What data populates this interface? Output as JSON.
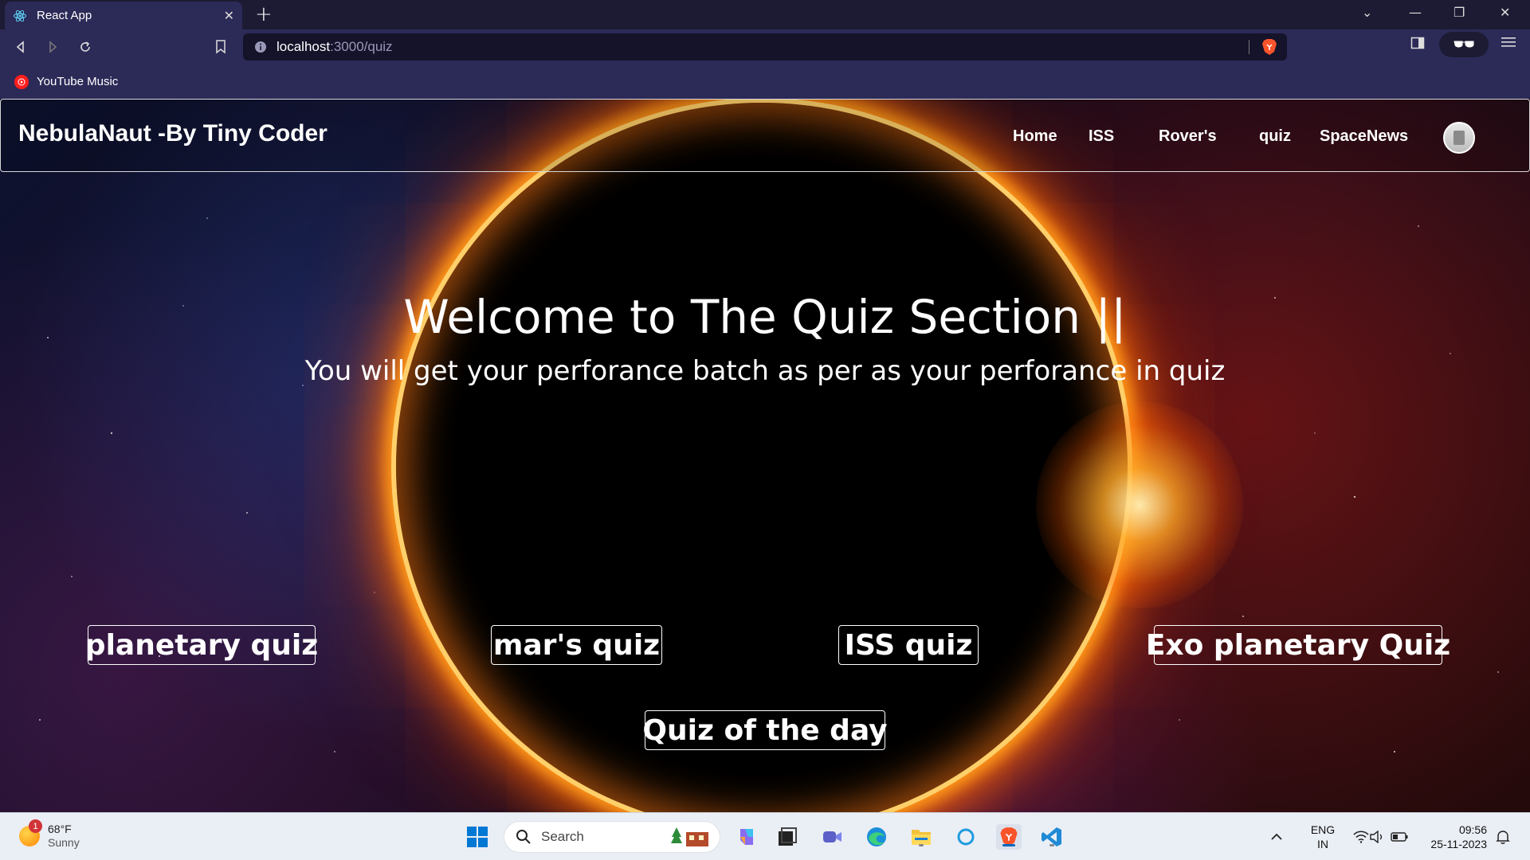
{
  "browser": {
    "tab_title": "React App",
    "url_host": "localhost",
    "url_path": ":3000/quiz",
    "bookmark_label": "YouTube Music"
  },
  "site": {
    "brand": "NebulaNaut -By Tiny Coder",
    "nav_links": [
      "Home",
      "ISS",
      "Rover's",
      "quiz",
      "SpaceNews"
    ]
  },
  "hero": {
    "title": "Welcome to The Quiz Section ||",
    "subtitle": "You will get your perforance batch as per as your perforance in quiz"
  },
  "quizzes": {
    "planetary": "planetary quiz",
    "mars": "mar's quiz",
    "iss": "ISS quiz",
    "exo": "Exo planetary Quiz",
    "daily": "Quiz of the day"
  },
  "taskbar": {
    "weather_temp": "68°F",
    "weather_condition": "Sunny",
    "weather_badge": "1",
    "search_label": "Search",
    "lang_line1": "ENG",
    "lang_line2": "IN",
    "time": "09:56",
    "date": "25-11-2023"
  },
  "colors": {
    "chrome_bg": "#2c2a57",
    "tab_bar_bg": "#1c1b33",
    "brave_orange": "#fb542b",
    "accent_blue": "#0067c0"
  }
}
